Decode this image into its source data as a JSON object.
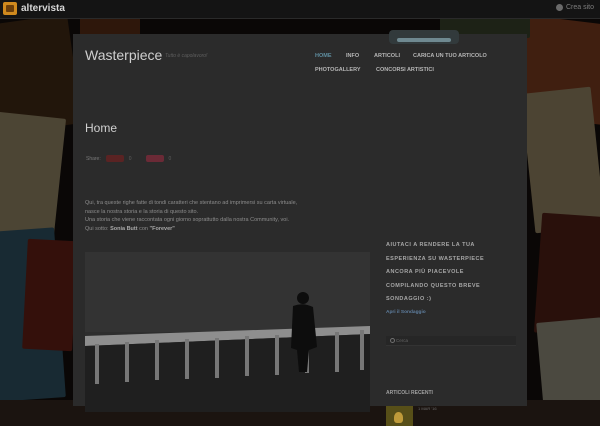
{
  "topbar": {
    "logo_text": "altervista",
    "right_label": "Crea sito"
  },
  "site": {
    "title": "Wasterpiece",
    "tagline": "Tutto è capolavoro!"
  },
  "nav": {
    "items": [
      {
        "label": "HOME",
        "active": true
      },
      {
        "label": "INFO",
        "active": false
      },
      {
        "label": "ARTICOLI",
        "active": false
      },
      {
        "label": "CARICA UN TUO ARTICOLO",
        "active": false
      },
      {
        "label": "PHOTOGALLERY",
        "active": false
      },
      {
        "label": "CONCORSI ARTISTICI",
        "active": false
      }
    ]
  },
  "page": {
    "title": "Home",
    "share_label": "Share:",
    "share_counts": [
      "0",
      "0"
    ]
  },
  "content": {
    "line1": "Qui, tra queste righe fatte di tondi caratteri che stentano ad imprimersi su carta virtuale,",
    "line2": "nasce la nostra storia e la storia di questo sito.",
    "line3": "Una storia che viene raccontata ogni giorno soprattutto dalla nostra Community, voi.",
    "line4_prefix": "Qui sotto: ",
    "line4_author": "Sonia Butt",
    "line4_mid": " con ",
    "line4_work": "\"Forever\""
  },
  "sidebar": {
    "survey_lines": [
      "AIUTACI A RENDERE LA TUA",
      "ESPERIENZA SU WASTERPIECE",
      "ANCORA PIÙ PIACEVOLE",
      "COMPILANDO QUESTO BREVE",
      "SONDAGGIO :)"
    ],
    "survey_link": "Apri il Sondaggio",
    "search_placeholder": "Cerca",
    "recent_heading": "ARTICOLI RECENTI",
    "recent_date": "1 MAR '16"
  },
  "colors": {
    "accent": "#5f8ea0",
    "page_bg": "#2b2b2b"
  }
}
